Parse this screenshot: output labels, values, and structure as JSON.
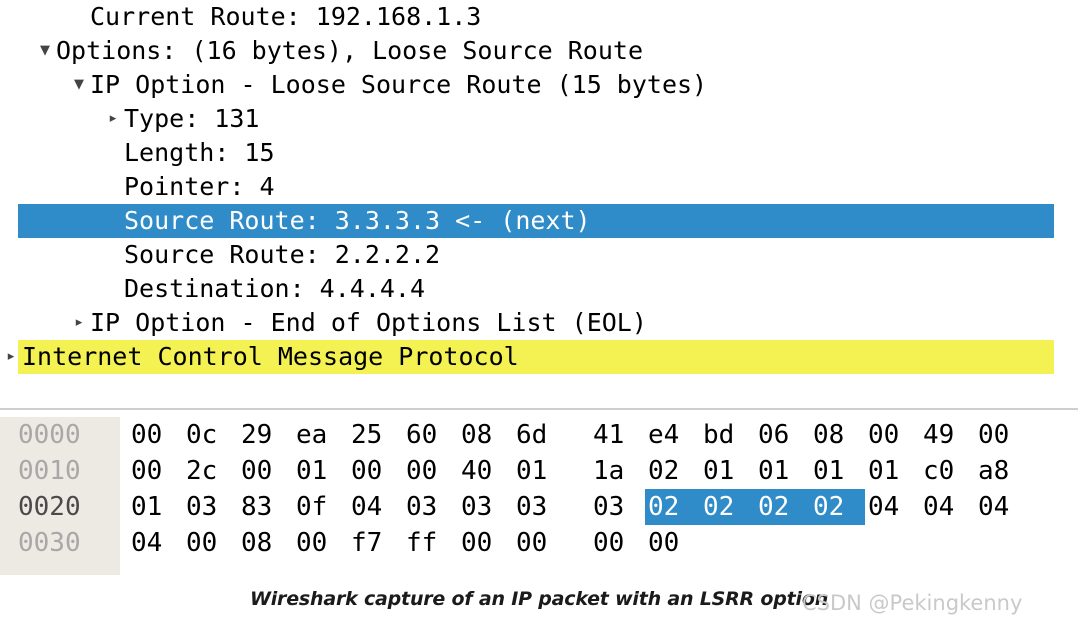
{
  "app": "wireshark-packet-detail",
  "colors": {
    "selection_blue": "#2f8cc9",
    "highlight_yellow": "#f4f252",
    "hex_offset_bg": "#edeae3",
    "offset_text": "#a8a8a8",
    "offset_text_active": "#4a4a4a"
  },
  "tree": {
    "rows": [
      {
        "text": "Current Route: 192.168.1.3",
        "indent": 2,
        "twisty": "",
        "state": "normal",
        "name": "tree-row-current-route"
      },
      {
        "text": "Options: (16 bytes), Loose Source Route",
        "indent": 1,
        "twisty": "expanded",
        "state": "normal",
        "name": "tree-row-options"
      },
      {
        "text": "IP Option - Loose Source Route (15 bytes)",
        "indent": 2,
        "twisty": "expanded",
        "state": "normal",
        "name": "tree-row-ip-option-lsrr"
      },
      {
        "text": "Type: 131",
        "indent": 3,
        "twisty": "collapsed",
        "state": "normal",
        "name": "tree-row-type"
      },
      {
        "text": "Length: 15",
        "indent": 3,
        "twisty": "",
        "state": "normal",
        "name": "tree-row-length"
      },
      {
        "text": "Pointer: 4",
        "indent": 3,
        "twisty": "",
        "state": "normal",
        "name": "tree-row-pointer"
      },
      {
        "text": "Source Route: 3.3.3.3 <- (next)",
        "indent": 3,
        "twisty": "",
        "state": "selected",
        "name": "tree-row-source-route-3"
      },
      {
        "text": "Source Route: 2.2.2.2",
        "indent": 3,
        "twisty": "",
        "state": "normal",
        "name": "tree-row-source-route-2"
      },
      {
        "text": "Destination: 4.4.4.4",
        "indent": 3,
        "twisty": "",
        "state": "normal",
        "name": "tree-row-destination"
      },
      {
        "text": "IP Option - End of Options List (EOL)",
        "indent": 2,
        "twisty": "collapsed",
        "state": "normal",
        "name": "tree-row-ip-option-eol"
      },
      {
        "text": "Internet Control Message Protocol",
        "indent": 0,
        "twisty": "collapsed",
        "state": "highlight",
        "name": "tree-row-icmp"
      }
    ],
    "twisty_glyphs": {
      "expanded": "▼",
      "collapsed": "▸"
    }
  },
  "hexdump": {
    "rows": [
      {
        "offset": "0000",
        "offset_active": false,
        "bytes": [
          "00",
          "0c",
          "29",
          "ea",
          "25",
          "60",
          "08",
          "6d",
          "41",
          "e4",
          "bd",
          "06",
          "08",
          "00",
          "49",
          "00"
        ],
        "selected_indices": []
      },
      {
        "offset": "0010",
        "offset_active": false,
        "bytes": [
          "00",
          "2c",
          "00",
          "01",
          "00",
          "00",
          "40",
          "01",
          "1a",
          "02",
          "01",
          "01",
          "01",
          "01",
          "c0",
          "a8"
        ],
        "selected_indices": []
      },
      {
        "offset": "0020",
        "offset_active": true,
        "bytes": [
          "01",
          "03",
          "83",
          "0f",
          "04",
          "03",
          "03",
          "03",
          "03",
          "02",
          "02",
          "02",
          "02",
          "04",
          "04",
          "04"
        ],
        "selected_indices": [
          9,
          10,
          11,
          12
        ]
      },
      {
        "offset": "0030",
        "offset_active": false,
        "bytes": [
          "04",
          "00",
          "08",
          "00",
          "f7",
          "ff",
          "00",
          "00",
          "00",
          "00"
        ],
        "selected_indices": []
      }
    ]
  },
  "caption": {
    "text": "Wireshark capture of an IP packet with an LSRR option",
    "watermark": "CSDN @Pekingkenny"
  }
}
